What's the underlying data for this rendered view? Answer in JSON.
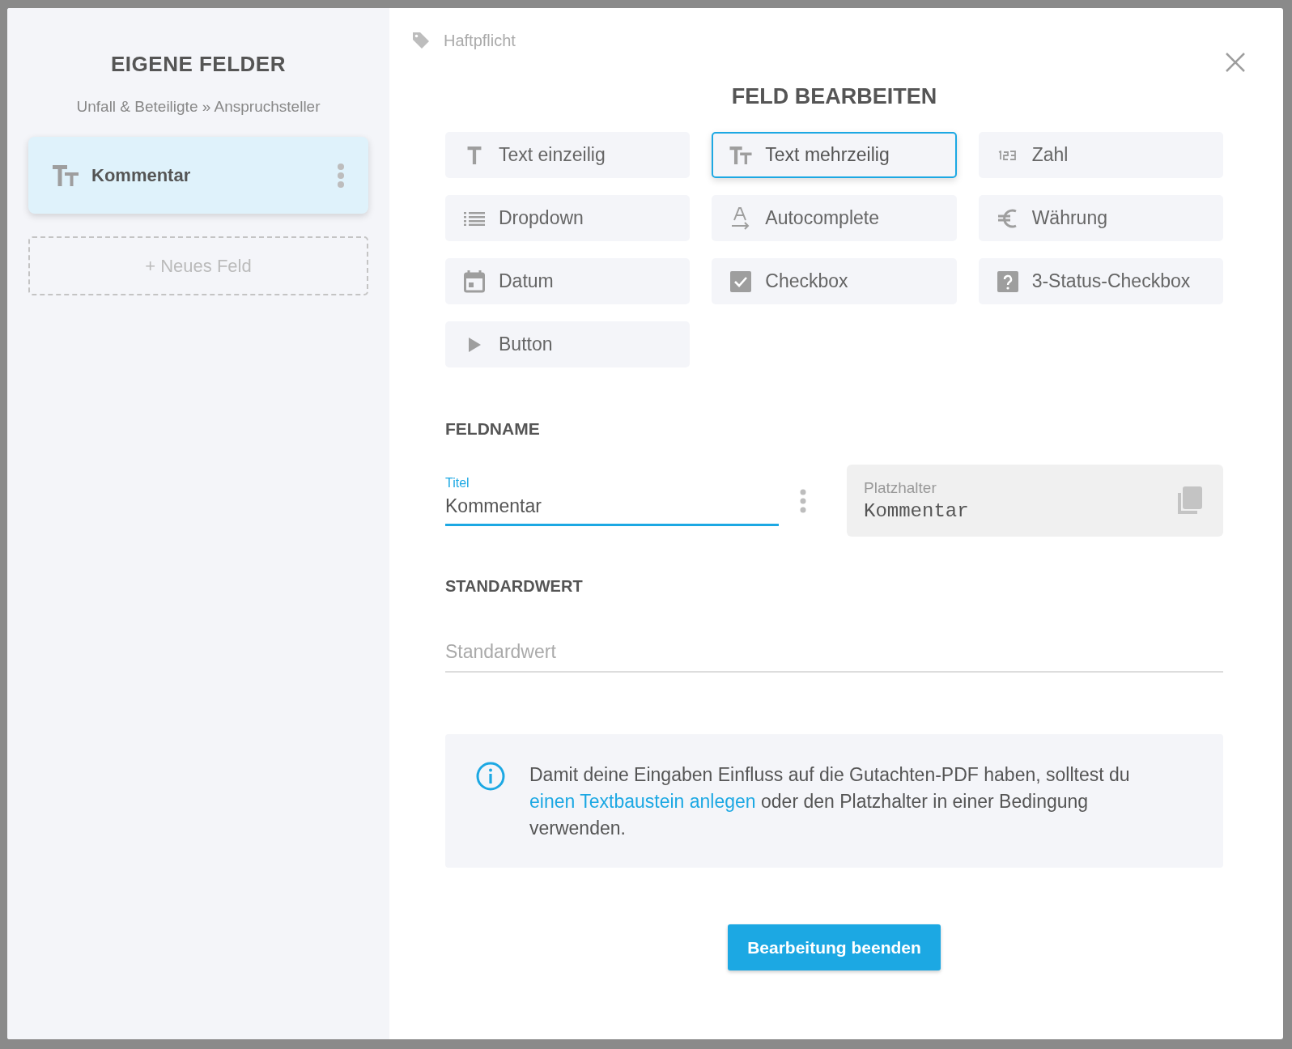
{
  "sidebar": {
    "title": "EIGENE FELDER",
    "breadcrumb": "Unfall & Beteiligte » Anspruchsteller",
    "fields": [
      {
        "label": "Kommentar",
        "kind": "multiline",
        "selected": true
      }
    ],
    "add_button": "+ Neues Feld"
  },
  "tag": "Haftpflicht",
  "title": "FELD BEARBEITEN",
  "field_types": [
    {
      "label": "Text einzeilig",
      "kind": "singleline",
      "selected": false
    },
    {
      "label": "Text mehrzeilig",
      "kind": "multiline",
      "selected": true
    },
    {
      "label": "Zahl",
      "kind": "number",
      "selected": false
    },
    {
      "label": "Dropdown",
      "kind": "dropdown",
      "selected": false
    },
    {
      "label": "Autocomplete",
      "kind": "autocomplete",
      "selected": false
    },
    {
      "label": "Währung",
      "kind": "currency",
      "selected": false
    },
    {
      "label": "Datum",
      "kind": "date",
      "selected": false
    },
    {
      "label": "Checkbox",
      "kind": "checkbox",
      "selected": false
    },
    {
      "label": "3-Status-Checkbox",
      "kind": "tristate",
      "selected": false
    },
    {
      "label": "Button",
      "kind": "button",
      "selected": false
    }
  ],
  "feldname": {
    "heading": "FELDNAME",
    "title_label": "Titel",
    "title_value": "Kommentar",
    "placeholder_label": "Platzhalter",
    "placeholder_value": "Kommentar"
  },
  "standardwert": {
    "heading": "STANDARDWERT",
    "placeholder": "Standardwert"
  },
  "info": {
    "before": "Damit deine Eingaben Einfluss auf die Gutachten-PDF haben, solltest du ",
    "link": "einen Textbaustein anlegen",
    "after": " oder den Platzhalter in einer Bedingung verwenden."
  },
  "finish_button": "Bearbeitung beenden"
}
